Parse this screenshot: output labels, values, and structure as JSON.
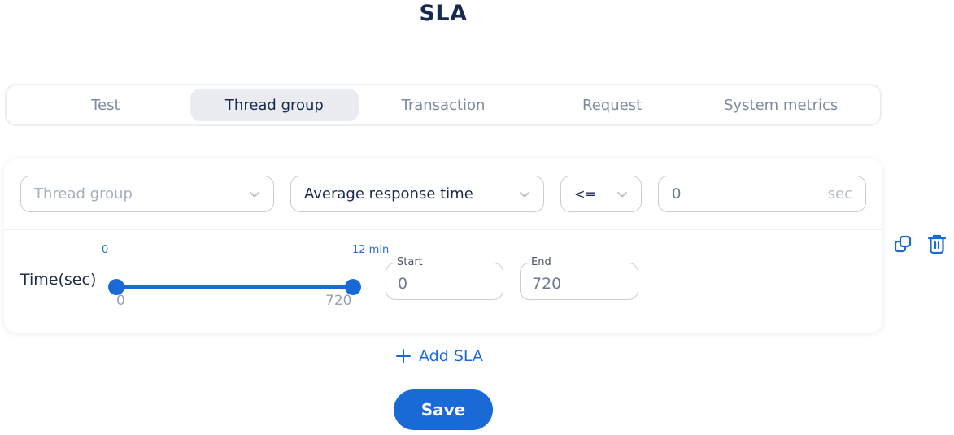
{
  "header": {
    "title": "SLA"
  },
  "tabs": [
    {
      "label": "Test",
      "active": false
    },
    {
      "label": "Thread group",
      "active": true
    },
    {
      "label": "Transaction",
      "active": false
    },
    {
      "label": "Request",
      "active": false
    },
    {
      "label": "System metrics",
      "active": false
    }
  ],
  "sla_rule": {
    "thread_group_select": {
      "placeholder": "Thread group",
      "value": ""
    },
    "metric_select": {
      "value": "Average response time"
    },
    "operator_select": {
      "value": "<="
    },
    "threshold_input": {
      "value": "0",
      "unit": "sec"
    },
    "time_range": {
      "label": "Time(sec)",
      "min_label_top": "0",
      "max_label_top": "12 min",
      "min_label_bottom": "0",
      "max_label_bottom": "720",
      "range_min": 0,
      "range_max": 720,
      "selected_start": 0,
      "selected_end": 720,
      "accent_color": "#1a6ad6"
    },
    "start_field": {
      "legend": "Start",
      "value": "0"
    },
    "end_field": {
      "legend": "End",
      "value": "720"
    },
    "actions": {
      "duplicate_icon": "duplicate-icon",
      "delete_icon": "trash-icon"
    }
  },
  "add_sla": {
    "label": "Add SLA",
    "icon": "plus-icon"
  },
  "save": {
    "label": "Save"
  },
  "colors": {
    "primary": "#1a6ad6",
    "title": "#152a4e",
    "muted": "#7d8ba0"
  }
}
